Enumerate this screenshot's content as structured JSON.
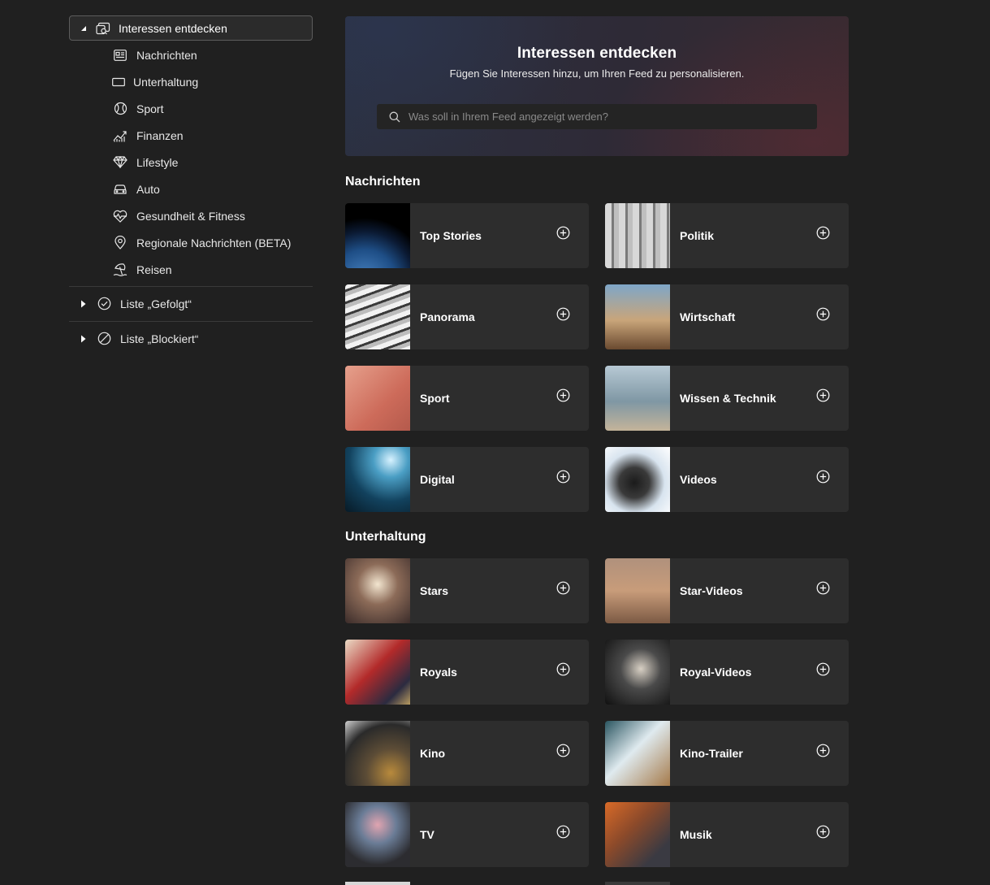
{
  "sidebar": {
    "root": {
      "label": "Interessen entdecken",
      "expanded": true
    },
    "items": [
      {
        "label": "Nachrichten",
        "icon": "newspaper-icon"
      },
      {
        "label": "Unterhaltung",
        "icon": "tv-screen-icon"
      },
      {
        "label": "Sport",
        "icon": "baseball-icon"
      },
      {
        "label": "Finanzen",
        "icon": "chart-trend-icon"
      },
      {
        "label": "Lifestyle",
        "icon": "diamond-icon"
      },
      {
        "label": "Auto",
        "icon": "car-icon"
      },
      {
        "label": "Gesundheit & Fitness",
        "icon": "heart-pulse-icon"
      },
      {
        "label": "Regionale Nachrichten (BETA)",
        "icon": "map-pin-icon"
      },
      {
        "label": "Reisen",
        "icon": "beach-umbrella-icon"
      }
    ],
    "groups": [
      {
        "label": "Liste „Gefolgt“",
        "icon": "check-circle-icon"
      },
      {
        "label": "Liste „Blockiert“",
        "icon": "block-circle-icon"
      }
    ]
  },
  "hero": {
    "title": "Interessen entdecken",
    "subtitle": "Fügen Sie Interessen hinzu, um Ihren Feed zu personalisieren.",
    "search_placeholder": "Was soll in Ihrem Feed angezeigt werden?"
  },
  "sections": [
    {
      "title": "Nachrichten",
      "cards": [
        {
          "label": "Top Stories",
          "thumb": "earth-from-space"
        },
        {
          "label": "Politik",
          "thumb": "columns"
        },
        {
          "label": "Panorama",
          "thumb": "newspapers"
        },
        {
          "label": "Wirtschaft",
          "thumb": "skyscrapers"
        },
        {
          "label": "Sport",
          "thumb": "runners"
        },
        {
          "label": "Wissen & Technik",
          "thumb": "lab-glass"
        },
        {
          "label": "Digital",
          "thumb": "fiber-optics"
        },
        {
          "label": "Videos",
          "thumb": "film-camera"
        }
      ]
    },
    {
      "title": "Unterhaltung",
      "cards": [
        {
          "label": "Stars",
          "thumb": "paparazzi"
        },
        {
          "label": "Star-Videos",
          "thumb": "dancer"
        },
        {
          "label": "Royals",
          "thumb": "royal-couple"
        },
        {
          "label": "Royal-Videos",
          "thumb": "person-in-hat"
        },
        {
          "label": "Kino",
          "thumb": "film-reel"
        },
        {
          "label": "Kino-Trailer",
          "thumb": "tablet-movie"
        },
        {
          "label": "TV",
          "thumb": "television"
        },
        {
          "label": "Musik",
          "thumb": "guitar"
        }
      ]
    }
  ],
  "colors": {
    "background": "#202020",
    "card": "#2d2d2d",
    "border": "#5c5c5c"
  }
}
